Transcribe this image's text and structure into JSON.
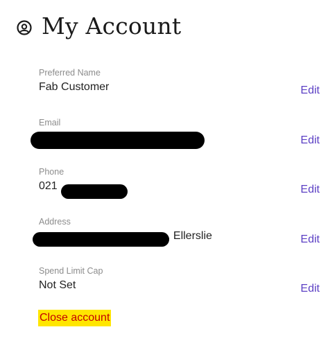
{
  "header": {
    "icon": "account-circle-icon",
    "title": "My Account"
  },
  "fields": [
    {
      "label": "Preferred Name",
      "value": "Fab Customer",
      "edit": "Edit"
    },
    {
      "label": "Email",
      "value": "",
      "edit": "Edit"
    },
    {
      "label": "Phone",
      "value": "021",
      "edit": "Edit"
    },
    {
      "label": "Address",
      "value": ", Ellerslie",
      "edit": "Edit"
    },
    {
      "label": "Spend Limit Cap",
      "value": "Not Set",
      "edit": "Edit"
    }
  ],
  "actions": {
    "close_account": "Close account"
  },
  "colors": {
    "accent": "#5b3fc4",
    "label": "#8c8c8c",
    "danger_text": "#c40000",
    "highlight": "#ffe600"
  }
}
